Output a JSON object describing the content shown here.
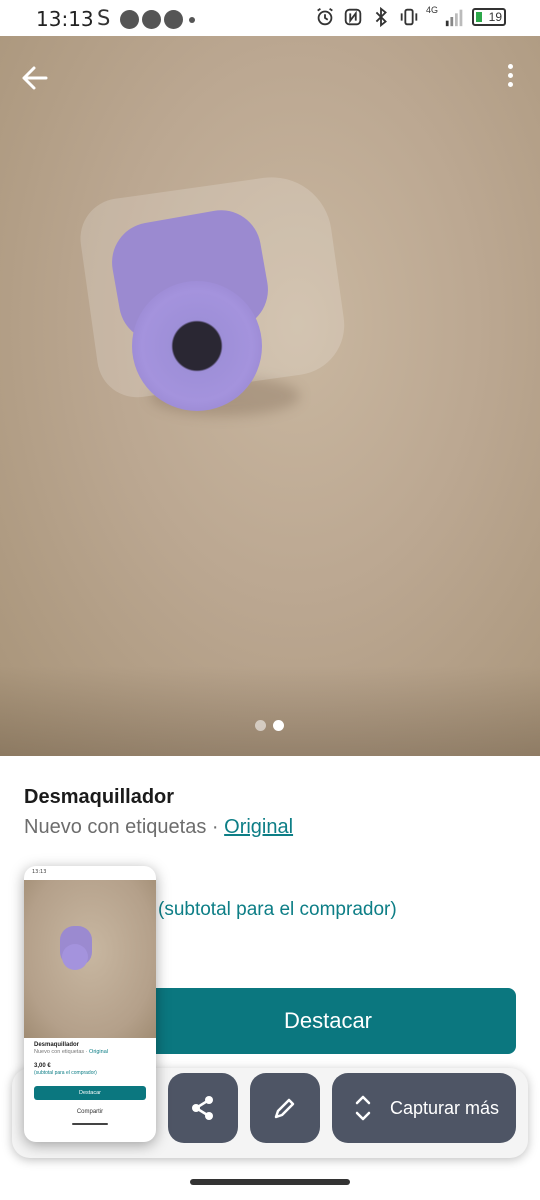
{
  "status_bar": {
    "time": "13:13",
    "notification_letter": "S",
    "network_type": "4G",
    "battery_level": "19",
    "battery_color": "#2da84a"
  },
  "listing": {
    "title": "Desmaquillador",
    "condition": "Nuevo con etiquetas",
    "separator": "·",
    "brand": "Original",
    "subtotal_note": "(subtotal para el comprador)",
    "feature_button": "Destacar",
    "image_count": 2,
    "active_image": 2
  },
  "screenshot_toolbar": {
    "capture_more_label": "Capturar más",
    "icons": [
      "share-icon",
      "pencil-icon",
      "expand-vertical-icon"
    ]
  },
  "thumbnail": {
    "status_time": "13:13",
    "title": "Desmaquillador",
    "condition": "Nuevo con etiquetas",
    "brand": "Original",
    "price": "3,00 €",
    "feature_button": "Destacar",
    "share_label": "Compartir"
  },
  "colors": {
    "accent": "#0b777f",
    "link": "#0d7e86",
    "toolbar_button": "#4e5565"
  }
}
